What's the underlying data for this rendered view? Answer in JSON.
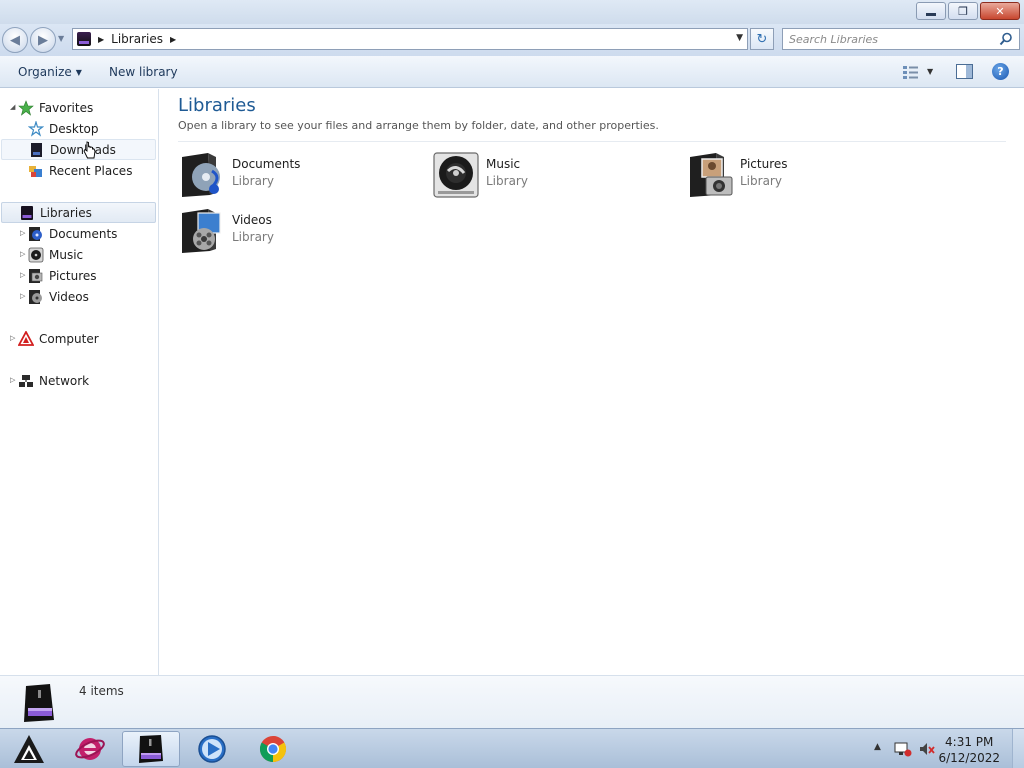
{
  "window": {
    "minimize_glyph": "",
    "maximize_glyph": "❐",
    "close_glyph": "✕"
  },
  "address_bar": {
    "path": [
      "Libraries"
    ],
    "search_placeholder": "Search Libraries"
  },
  "command_bar": {
    "organize_label": "Organize",
    "new_library_label": "New library"
  },
  "nav_pane": {
    "favorites": {
      "label": "Favorites",
      "items": [
        {
          "label": "Desktop",
          "icon": "desktop-icon"
        },
        {
          "label": "Downloads",
          "icon": "downloads-icon"
        },
        {
          "label": "Recent Places",
          "icon": "recent-places-icon"
        }
      ]
    },
    "libraries": {
      "label": "Libraries",
      "items": [
        {
          "label": "Documents",
          "icon": "documents-library-icon"
        },
        {
          "label": "Music",
          "icon": "music-library-icon"
        },
        {
          "label": "Pictures",
          "icon": "pictures-library-icon"
        },
        {
          "label": "Videos",
          "icon": "videos-library-icon"
        }
      ]
    },
    "computer": {
      "label": "Computer"
    },
    "network": {
      "label": "Network"
    }
  },
  "content": {
    "title": "Libraries",
    "subtitle": "Open a library to see your files and arrange them by folder, date, and other properties.",
    "libraries": [
      {
        "name": "Documents",
        "type": "Library",
        "icon": "documents-library-icon"
      },
      {
        "name": "Music",
        "type": "Library",
        "icon": "music-library-icon"
      },
      {
        "name": "Pictures",
        "type": "Library",
        "icon": "pictures-library-icon"
      },
      {
        "name": "Videos",
        "type": "Library",
        "icon": "videos-library-icon"
      }
    ]
  },
  "details_pane": {
    "item_count": "4 items"
  },
  "taskbar": {
    "time": "4:31 PM",
    "date": "6/12/2022",
    "apps": [
      "start-icon",
      "internet-explorer-icon",
      "windows-explorer-icon",
      "media-player-icon",
      "chrome-icon"
    ]
  },
  "colors": {
    "title_accent": "#1e5a94",
    "secondary_text": "#7a7a7a"
  }
}
